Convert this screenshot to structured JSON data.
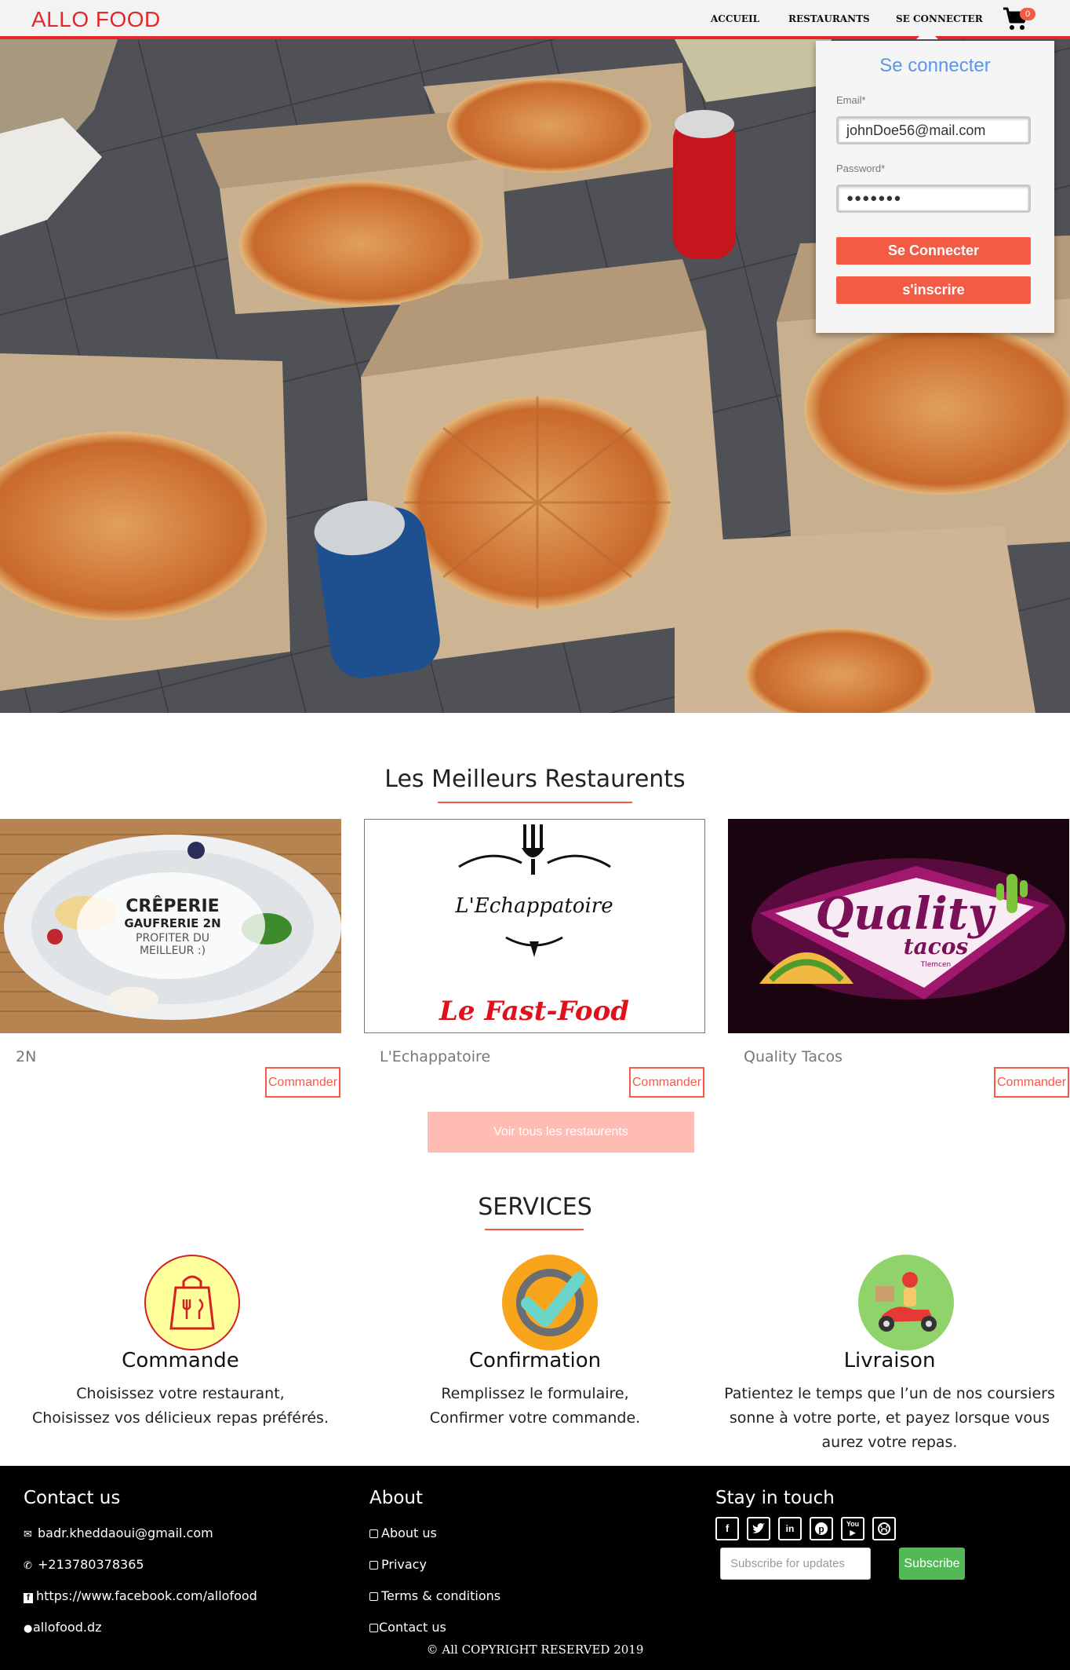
{
  "brand": "ALLO FOOD",
  "nav": {
    "home": "ACCUEIL",
    "restaurants": "RESTAURANTS",
    "login": "SE CONNECTER",
    "cart_count": "0",
    "cart_icon": "shopping-cart-icon"
  },
  "login_form": {
    "title": "Se connecter",
    "email_label": "Email*",
    "email_value": "johnDoe56@mail.com",
    "password_label": "Password*",
    "password_value": "●●●●●●●",
    "submit_label": "Se Connecter",
    "register_label": "s'inscrire"
  },
  "restaurants": {
    "title": "Les Meilleurs Restaurents",
    "items": [
      {
        "name": "2N",
        "order_label": "Commander",
        "logo_lines": [
          "CRÊPERIE",
          "GAUFRERIE 2N",
          "PROFITER DU",
          "MEILLEUR :)"
        ]
      },
      {
        "name": "L'Echappatoire",
        "order_label": "Commander",
        "logo_lines": [
          "L'Echappatoire",
          "Le Fast-Food"
        ]
      },
      {
        "name": "Quality Tacos",
        "order_label": "Commander",
        "logo_lines": [
          "Quality",
          "tacos",
          "Tlemcen"
        ]
      }
    ],
    "see_all_label": "Voir tous les restaurents"
  },
  "services": {
    "title": "SERVICES",
    "items": [
      {
        "title": "Commande",
        "text_lines": [
          "Choisissez votre restaurant,",
          "Choisissez vos délicieux repas préférés."
        ],
        "icon": "shopping-bag-icon"
      },
      {
        "title": "Confirmation",
        "text_lines": [
          "Remplissez le formulaire,",
          "Confirmer votre commande."
        ],
        "icon": "checkmark-icon"
      },
      {
        "title": "Livraison",
        "text_lines": [
          "Patientez le temps que l’un de nos coursiers",
          "sonne à votre porte, et payez lorsque vous",
          "aurez votre repas."
        ],
        "icon": "delivery-scooter-icon"
      }
    ]
  },
  "footer": {
    "contact": {
      "title": "Contact us",
      "email": "badr.kheddaoui@gmail.com",
      "phone": "+213780378365",
      "facebook": "https://www.facebook.com/allofood",
      "web": "allofood.dz"
    },
    "about": {
      "title": "About",
      "links": [
        "About us",
        "Privacy",
        "Terms & conditions",
        "Contact us"
      ]
    },
    "stay": {
      "title": "Stay in touch",
      "social_icons": [
        "facebook-icon",
        "twitter-icon",
        "linkedin-icon",
        "pinterest-icon",
        "youtube-icon",
        "github-icon"
      ],
      "subscribe_placeholder": "Subscribe for updates",
      "subscribe_label": "Subscribe"
    },
    "copyright": "© All COPYRIGHT RESERVED 2019"
  },
  "colors": {
    "brand_red": "#e8262a",
    "accent": "#f45b45",
    "link_blue": "#5b95e8",
    "subscribe_green": "#52b956"
  }
}
